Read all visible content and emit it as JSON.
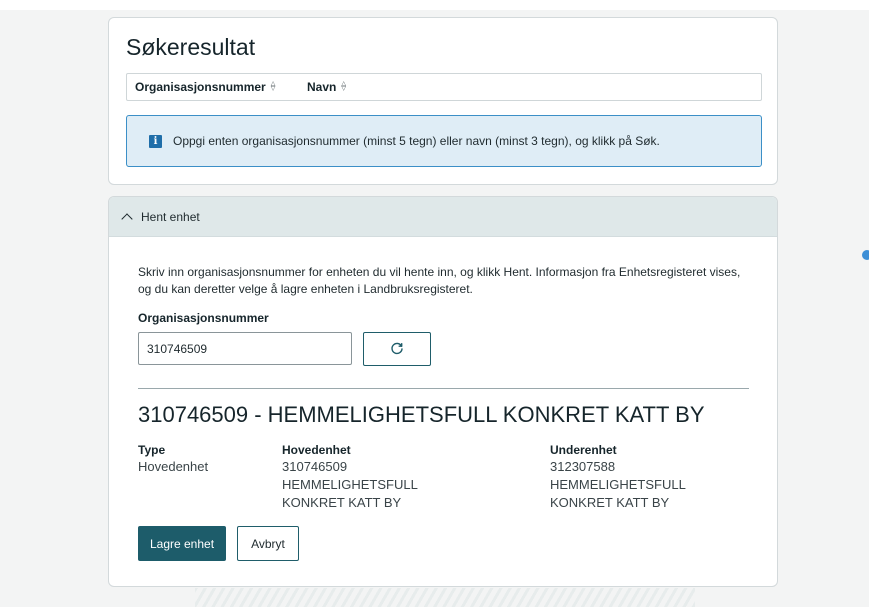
{
  "search_results": {
    "title": "Søkeresultat",
    "columns": [
      {
        "label": "Organisasjonsnummer"
      },
      {
        "label": "Navn"
      }
    ],
    "info_message": "Oppgi enten organisasjonsnummer (minst 5 tegn) eller navn (minst 3 tegn), og klikk på Søk."
  },
  "fetch_unit": {
    "accordion_title": "Hent enhet",
    "description": "Skriv inn organisasjonsnummer for enheten du vil hente inn, og klikk Hent. Informasjon fra Enhetsregisteret vises, og du kan deretter velge å lagre enheten i Landbruksregisteret.",
    "field_label": "Organisasjonsnummer",
    "field_value": "310746509",
    "result_title": "310746509 - HEMMELIGHETSFULL KONKRET KATT BY",
    "details": {
      "type_label": "Type",
      "type_value": "Hovedenhet",
      "main_label": "Hovedenhet",
      "main_number": "310746509",
      "main_name": "HEMMELIGHETSFULL KONKRET KATT BY",
      "sub_label": "Underenhet",
      "sub_number": "312307588",
      "sub_name": "HEMMELIGHETSFULL KONKRET KATT BY"
    },
    "save_label": "Lagre enhet",
    "cancel_label": "Avbryt"
  },
  "colors": {
    "primary": "#1d5c6a",
    "info_bg": "#dfedf6",
    "info_border": "#3b8fc7",
    "accordion_bg": "#dfe8e9"
  },
  "icons": [
    "sort-icon",
    "info-icon",
    "chevron-up-icon",
    "refresh-icon"
  ]
}
